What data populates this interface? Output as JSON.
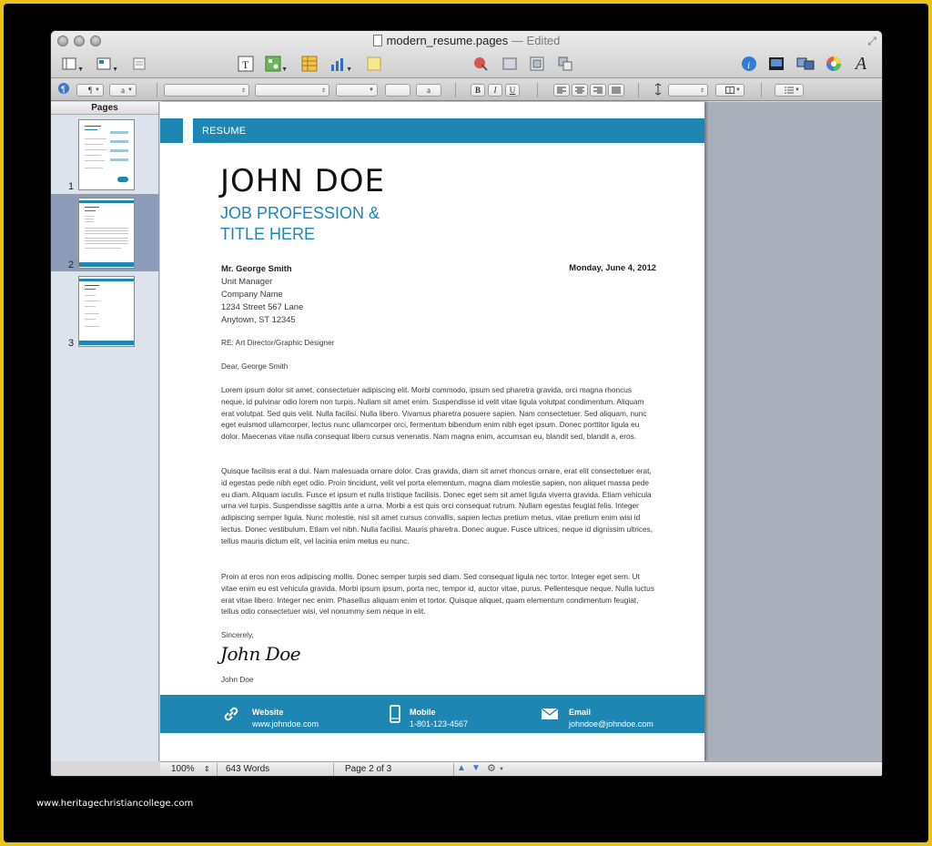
{
  "window": {
    "title": "modern_resume.pages",
    "separator": " — ",
    "state": "Edited"
  },
  "sidebar": {
    "title": "Pages",
    "thumbnails": [
      {
        "label": "1",
        "selected": false
      },
      {
        "label": "2",
        "selected": true
      },
      {
        "label": "3",
        "selected": false
      }
    ]
  },
  "document": {
    "band_label": "RESUME",
    "name": "JOHN DOE",
    "profession_line1": "JOB PROFESSION &",
    "profession_line2": "TITLE HERE",
    "recipient": {
      "name": "Mr. George Smith",
      "title": "Unit Manager",
      "company": "Company Name",
      "street": "1234 Street 567 Lane",
      "city": "Anytown, ST 12345"
    },
    "date": "Monday, June 4, 2012",
    "re_line": "RE: Art Director/Graphic Designer",
    "salutation": "Dear, George Smith",
    "paragraphs": [
      "Lorem ipsum dolor sit amet, consectetuer adipiscing elit. Morbi commodo, ipsum sed pharetra gravida, orci magna rhoncus neque, id pulvinar odio lorem non turpis. Nullam sit amet enim. Suspendisse id velit vitae ligula volutpat condimentum. Aliquam erat volutpat. Sed quis velit. Nulla facilisi. Nulla libero. Vivamus pharetra posuere sapien. Nam consectetuer. Sed aliquam, nunc eget euismod ullamcorper, lectus nunc ullamcorper orci, fermentum bibendum enim nibh eget ipsum. Donec porttitor ligula eu dolor. Maecenas vitae nulla consequat libero cursus venenatis. Nam magna enim, accumsan eu, blandit sed, blandit a, eros.",
      "Quisque facilisis erat a dui. Nam malesuada ornare dolor. Cras gravida, diam sit amet rhoncus ornare, erat elit consectetuer erat, id egestas pede nibh eget odio. Proin tincidunt, velit vel porta elementum, magna diam molestie sapien, non aliquet massa pede eu diam. Aliquam iaculis. Fusce et ipsum et nulla tristique facilisis. Donec eget sem sit amet ligula viverra gravida. Etiam vehicula urna vel turpis. Suspendisse sagittis ante a urna. Morbi a est quis orci consequat rutrum. Nullam egestas feugiat felis. Integer adipiscing semper ligula. Nunc molestie, nisl sit amet cursus convallis, sapien lectus pretium metus, vitae pretium enim wisi id lectus. Donec vestibulum. Etiam vel nibh. Nulla facilisi. Mauris pharetra. Donec augue. Fusce ultrices, neque id dignissim ultrices, tellus mauris dictum elit, vel lacinia enim metus eu nunc.",
      "Proin at eros non eros adipiscing mollis. Donec semper turpis sed diam. Sed consequat ligula nec tortor. Integer eget sem. Ut vitae enim eu est vehicula gravida. Morbi ipsum ipsum, porta nec, tempor id, auctor vitae, purus. Pellentesque neque. Nulla luctus erat vitae libero. Integer nec enim. Phasellus aliquam enim et tortor. Quisque aliquet, quam elementum condimentum feugiat, tellus odio consectetuer wisi, vel nonummy sem neque in elit."
    ],
    "closing": "Sincerely,",
    "signature": "John Doe",
    "signer": "John Doe",
    "footer": {
      "website_label": "Website",
      "website_value": "www.johndoe.com",
      "mobile_label": "Mobile",
      "mobile_value": "1-801-123-4567",
      "email_label": "Email",
      "email_value": "johndoe@johndoe.com"
    }
  },
  "statusbar": {
    "zoom": "100%",
    "word_count": "643 Words",
    "page_indicator": "Page 2 of 3"
  },
  "formatbar": {
    "bold": "B",
    "italic": "I",
    "underline": "U",
    "text_style_glyph": "a"
  },
  "watermark": "www.heritagechristiancollege.com",
  "colors": {
    "accent": "#1d86b3",
    "outer_border": "#e8c21a"
  }
}
